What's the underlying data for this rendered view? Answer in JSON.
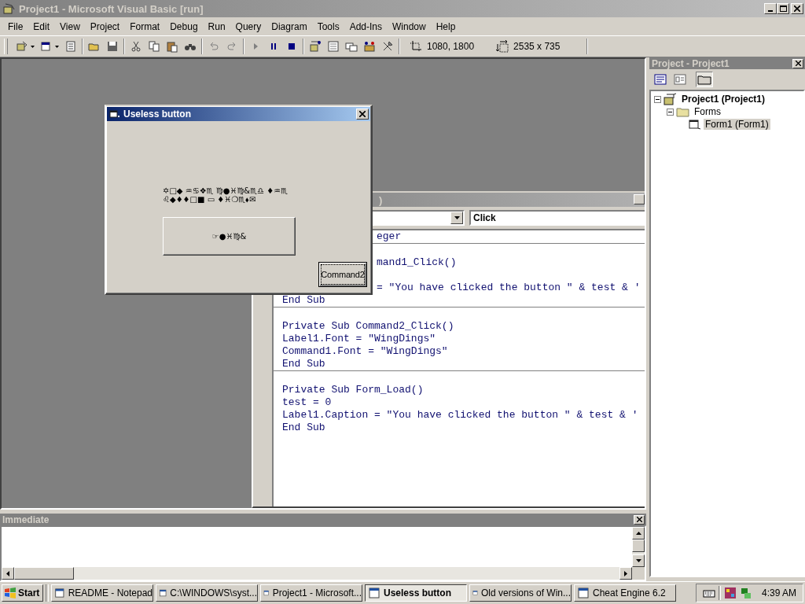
{
  "window": {
    "title": "Project1 - Microsoft Visual Basic [run]"
  },
  "menu": [
    "File",
    "Edit",
    "View",
    "Project",
    "Format",
    "Debug",
    "Run",
    "Query",
    "Diagram",
    "Tools",
    "Add-Ins",
    "Window",
    "Help"
  ],
  "toolbar": {
    "position": "1080, 1800",
    "size": "2535 x 735"
  },
  "code_window": {
    "title": ")",
    "procedure_combo": "Click",
    "procedures": [
      {
        "lines": [
          {
            "kind": "partial",
            "text": "eger"
          }
        ]
      },
      {
        "lines": [
          {
            "kind": "partial",
            "text": "mand1_Click()"
          },
          {
            "kind": "hidden"
          },
          {
            "kind": "partial",
            "text": "= \"You have clicked the button \" & test & '"
          },
          {
            "kind": "full",
            "text": "End Sub"
          }
        ]
      },
      {
        "lines": [
          {
            "kind": "full",
            "text": "Private Sub Command2_Click()"
          },
          {
            "kind": "full",
            "text": "Label1.Font = \"WingDings\""
          },
          {
            "kind": "full",
            "text": "Command1.Font = \"WingDings\""
          },
          {
            "kind": "full",
            "text": "End Sub"
          }
        ]
      },
      {
        "lines": [
          {
            "kind": "full",
            "text": "Private Sub Form_Load()"
          },
          {
            "kind": "full",
            "text": "test = 0"
          },
          {
            "kind": "full",
            "text": "Label1.Caption = \"You have clicked the button \" & test & '"
          },
          {
            "kind": "full",
            "text": "End Sub"
          }
        ]
      }
    ]
  },
  "dialog": {
    "title": "Useless button",
    "label_lines": [
      "✡□◆ ♒♋❖♏ ♍●♓♍&♏♎ ♦♒♏",
      "♌◆♦♦□■ ▭ ♦♓❍♏⬧✉"
    ],
    "command1": "☞●♓♍&",
    "command2": "Command2"
  },
  "project": {
    "title": "Project - Project1",
    "tree": [
      {
        "label": "Project1 (Project1)",
        "selected": false,
        "expanded": true,
        "children": [
          {
            "label": "Forms",
            "selected": false,
            "expanded": true,
            "children": [
              {
                "label": "Form1 (Form1)",
                "selected": true
              }
            ]
          }
        ]
      }
    ]
  },
  "immediate": {
    "title": "Immediate"
  },
  "taskbar": {
    "start": "Start",
    "tasks": [
      {
        "label": "README - Notepad",
        "selected": false
      },
      {
        "label": "C:\\WINDOWS\\syst...",
        "selected": false
      },
      {
        "label": "Project1 - Microsoft...",
        "selected": false
      },
      {
        "label": "Useless button",
        "selected": true
      },
      {
        "label": "Old versions of Win...",
        "selected": false
      },
      {
        "label": "Cheat Engine 6.2",
        "selected": false
      }
    ],
    "clock": "4:39 AM"
  }
}
